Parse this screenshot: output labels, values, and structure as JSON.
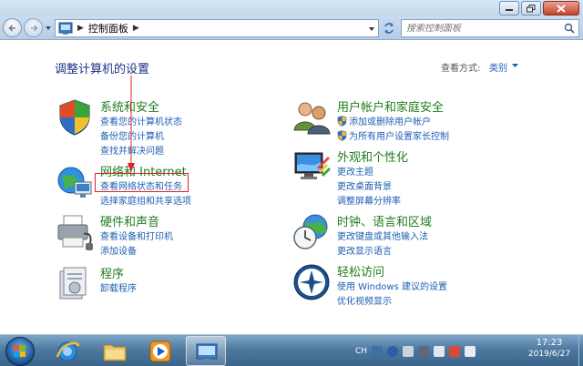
{
  "window": {
    "address_path": "控制面板",
    "search_placeholder": "搜索控制面板"
  },
  "header": {
    "title": "调整计算机的设置",
    "view_by_label": "查看方式:",
    "view_by_value": "类别"
  },
  "categories": [
    {
      "title": "系统和安全",
      "icon": "shield-icon",
      "links": [
        "查看您的计算机状态",
        "备份您的计算机",
        "查找并解决问题"
      ]
    },
    {
      "title": "网络和 Internet",
      "icon": "network-globe-icon",
      "links": [
        "查看网络状态和任务",
        "选择家庭组和共享选项"
      ]
    },
    {
      "title": "硬件和声音",
      "icon": "printer-icon",
      "links": [
        "查看设备和打印机",
        "添加设备"
      ]
    },
    {
      "title": "程序",
      "icon": "programs-icon",
      "links": [
        "卸载程序"
      ]
    },
    {
      "title": "用户帐户和家庭安全",
      "icon": "users-icon",
      "links": [
        "添加或删除用户帐户",
        "为所有用户设置家长控制"
      ]
    },
    {
      "title": "外观和个性化",
      "icon": "display-icon",
      "links": [
        "更改主题",
        "更改桌面背景",
        "调整屏幕分辨率"
      ]
    },
    {
      "title": "时钟、语言和区域",
      "icon": "clock-globe-icon",
      "links": [
        "更改键盘或其他输入法",
        "更改显示语言"
      ]
    },
    {
      "title": "轻松访问",
      "icon": "ease-of-access-icon",
      "links": [
        "使用 Windows 建议的设置",
        "优化视频显示"
      ]
    }
  ],
  "taskbar": {
    "apps": [
      "start-orb-icon",
      "internet-explorer-icon",
      "explorer-folder-icon",
      "media-player-icon",
      "control-panel-icon"
    ],
    "tray_language": "CH",
    "time": "17:23",
    "date": "2019/6/27"
  },
  "colors": {
    "category_title": "#1f7d1f",
    "link": "#1e5fb4",
    "page_title": "#1e3287",
    "highlight": "#e0202a"
  }
}
